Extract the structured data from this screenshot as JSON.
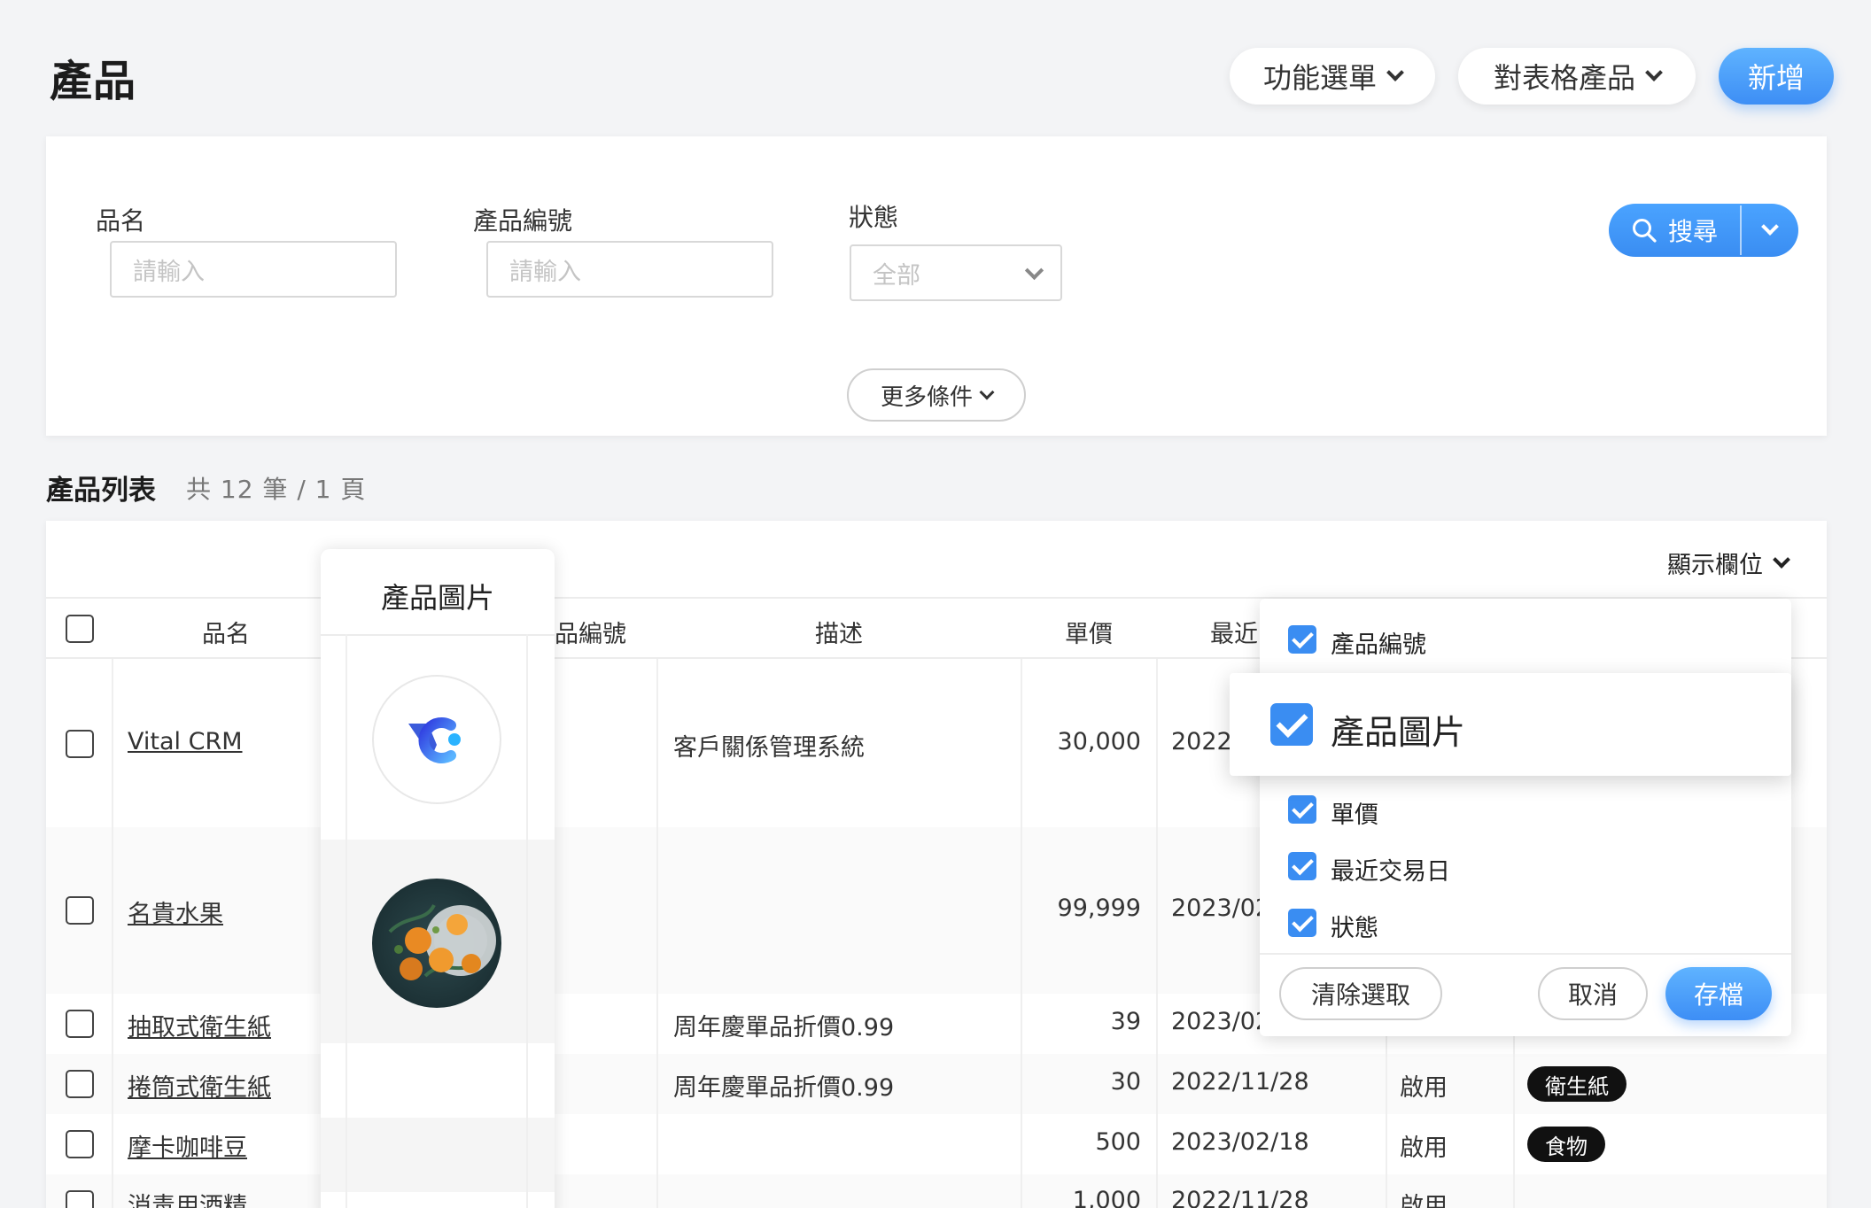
{
  "header": {
    "title": "產品",
    "menu_label": "功能選單",
    "bulk_label": "對表格產品",
    "add_label": "新增"
  },
  "filters": {
    "name_label": "品名",
    "name_placeholder": "請輸入",
    "code_label": "產品編號",
    "code_placeholder": "請輸入",
    "status_label": "狀態",
    "status_value": "全部",
    "more_label": "更多條件",
    "search_label": "搜尋"
  },
  "list": {
    "title": "產品列表",
    "count": "共 12 筆 / 1 頁",
    "show_columns": "顯示欄位",
    "headers": {
      "name": "品名",
      "image": "產品圖片",
      "code": "品編號",
      "desc": "描述",
      "price": "單價",
      "last": "最近"
    },
    "rows": [
      {
        "name": "Vital CRM",
        "desc": "客戶關係管理系統",
        "price": "30,000",
        "date": "2022/",
        "status": "",
        "category": ""
      },
      {
        "name": "名貴水果",
        "desc": "",
        "price": "99,999",
        "date": "2023/02",
        "status": "",
        "category": ""
      },
      {
        "name": "抽取式衛生紙",
        "desc": "周年慶單品折價0.99",
        "price": "39",
        "date": "2023/02",
        "status": "",
        "category": ""
      },
      {
        "name": "捲筒式衛生紙",
        "desc": "周年慶單品折價0.99",
        "price": "30",
        "date": "2022/11/28",
        "status": "啟用",
        "category": "衛生紙"
      },
      {
        "name": "摩卡咖啡豆",
        "desc": "",
        "price": "500",
        "date": "2023/02/18",
        "status": "啟用",
        "category": "食物"
      },
      {
        "name": "消毒用酒精",
        "desc": "",
        "price": "1,000",
        "date": "2022/11/28",
        "status": "啟用",
        "category": ""
      }
    ]
  },
  "column_chooser": {
    "items": [
      "產品編號",
      "產品圖片",
      "單價",
      "最近交易日",
      "狀態"
    ],
    "clear_label": "清除選取",
    "cancel_label": "取消",
    "save_label": "存檔"
  },
  "colors": {
    "accent": "#3a8df2",
    "background": "#f3f4f6"
  }
}
